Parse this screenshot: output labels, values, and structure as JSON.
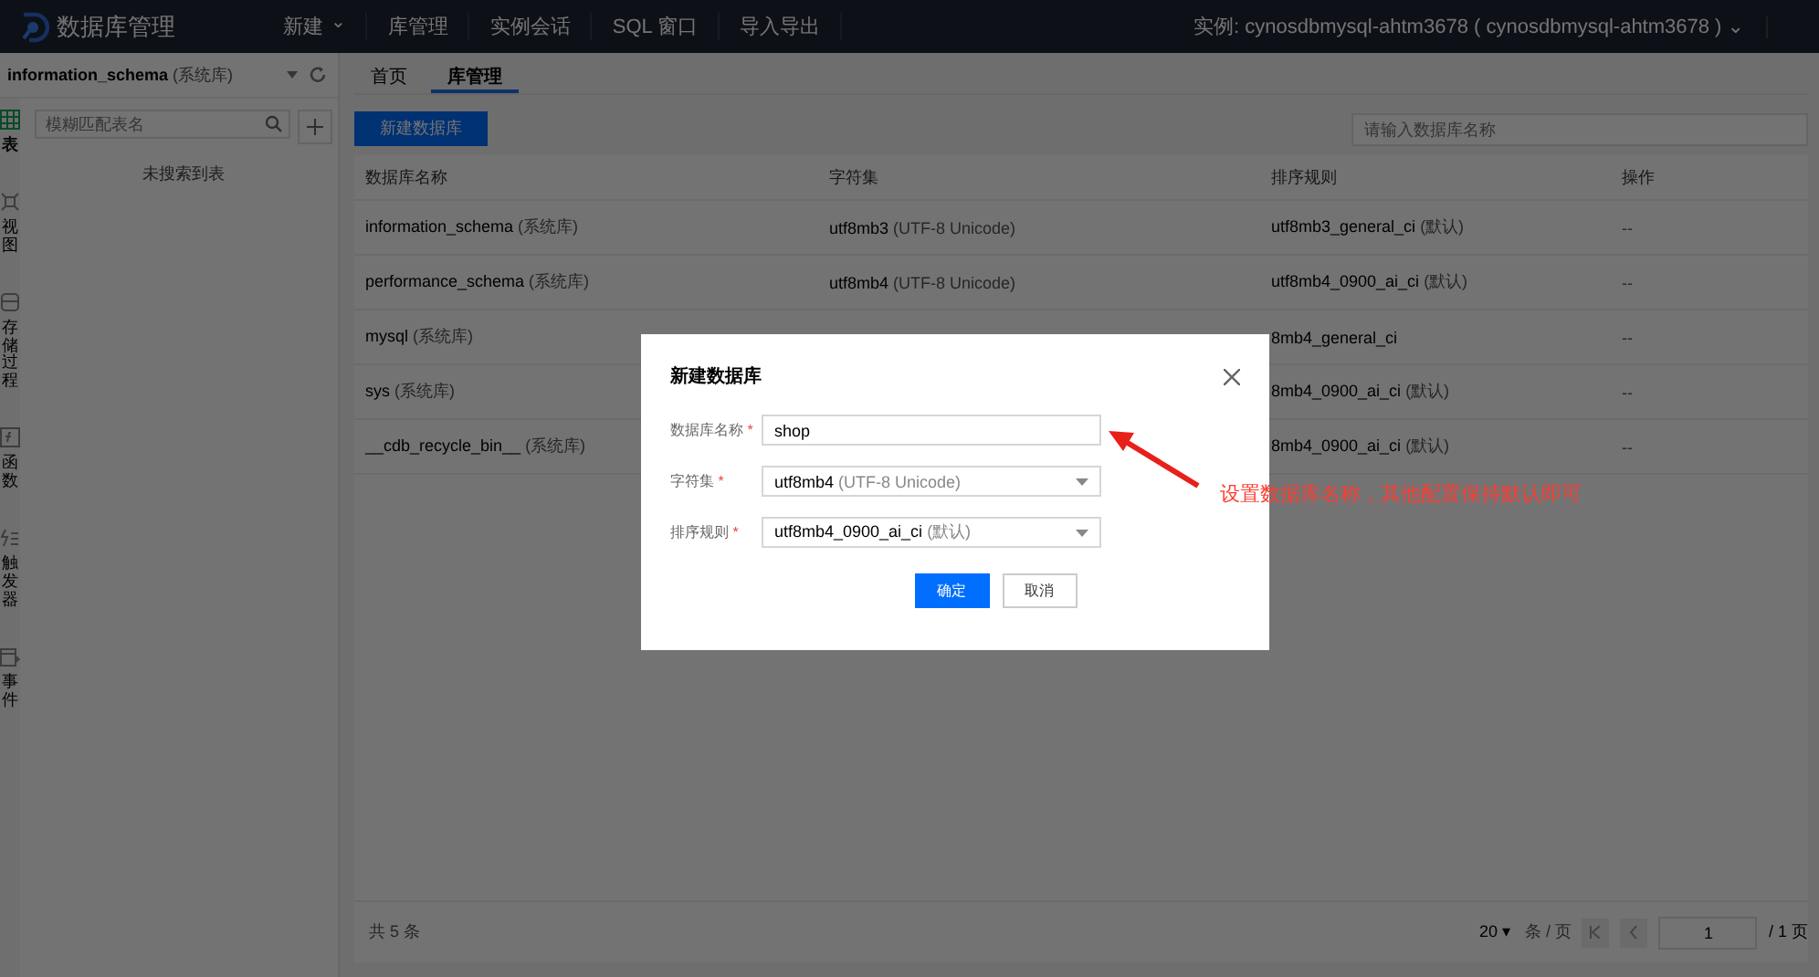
{
  "topbar": {
    "app_title": "数据库管理",
    "menu": [
      {
        "label": "新建",
        "caret": "⌄"
      },
      {
        "label": "库管理"
      },
      {
        "label": "实例会话"
      },
      {
        "label": "SQL 窗口"
      },
      {
        "label": "导入导出"
      }
    ],
    "instance_label": "实例: cynosdbmysql-ahtm3678 ( cynosdbmysql-ahtm3678 )",
    "instance_caret": "⌄"
  },
  "sidebar": {
    "database": "information_schema",
    "database_note": "(系统库)",
    "rail": [
      {
        "kind": "table",
        "label": "表",
        "selected": true
      },
      {
        "kind": "view",
        "label": "视图",
        "selected": false
      },
      {
        "kind": "procedure",
        "label": "存储过程",
        "selected": false
      },
      {
        "kind": "function",
        "label": "函数",
        "selected": false
      },
      {
        "kind": "trigger",
        "label": "触发器",
        "selected": false
      },
      {
        "kind": "event",
        "label": "事件",
        "selected": false
      }
    ],
    "search": {
      "placeholder": "模糊匹配表名"
    },
    "empty_text": "未搜索到表"
  },
  "tabs": [
    {
      "label": "首页",
      "selected": false
    },
    {
      "label": "库管理",
      "selected": true
    }
  ],
  "toolbar": {
    "create_button": "新建数据库",
    "search": {
      "placeholder": "请输入数据库名称"
    }
  },
  "table": {
    "columns": [
      "数据库名称",
      "字符集",
      "排序规则",
      "操作"
    ],
    "rows": [
      {
        "name": "information_schema",
        "name_note": "(系统库)",
        "charset": "utf8mb3",
        "charset_note": "(UTF-8 Unicode)",
        "collation": "utf8mb3_general_ci",
        "collation_note": "(默认)",
        "action": "--"
      },
      {
        "name": "performance_schema",
        "name_note": "(系统库)",
        "charset": "utf8mb4",
        "charset_note": "(UTF-8 Unicode)",
        "collation": "utf8mb4_0900_ai_ci",
        "collation_note": "(默认)",
        "action": "--"
      },
      {
        "name": "mysql",
        "name_note": "(系统库)",
        "collation": "8mb4_general_ci",
        "action": "--"
      },
      {
        "name": "sys",
        "name_note": "(系统库)",
        "collation": "8mb4_0900_ai_ci",
        "collation_note": "(默认)",
        "action": "--"
      },
      {
        "name": "__cdb_recycle_bin__",
        "name_note": "(系统库)",
        "collation": "8mb4_0900_ai_ci",
        "collation_note": "(默认)",
        "action": "--"
      }
    ]
  },
  "pagination": {
    "total": "共 5 条",
    "page_size": "20",
    "page_size_caret": "▾",
    "page_size_unit": "条 / 页",
    "page": "1",
    "page_total": "/ 1 页"
  },
  "dialog": {
    "title": "新建数据库",
    "fields": [
      {
        "kind": "input",
        "label": "数据库名称",
        "required_mark": "*",
        "value": "shop"
      },
      {
        "kind": "select",
        "label": "字符集",
        "required_mark": "*",
        "value": "utf8mb4",
        "note": "(UTF-8 Unicode)"
      },
      {
        "kind": "select",
        "label": "排序规则",
        "required_mark": "*",
        "value": "utf8mb4_0900_ai_ci",
        "note": "(默认)"
      }
    ],
    "buttons": [
      {
        "label": "确定",
        "kind": "primary"
      },
      {
        "label": "取消",
        "kind": "default"
      }
    ]
  },
  "annotation": {
    "text": "设置数据库名称，其他配置保持默认即可"
  }
}
